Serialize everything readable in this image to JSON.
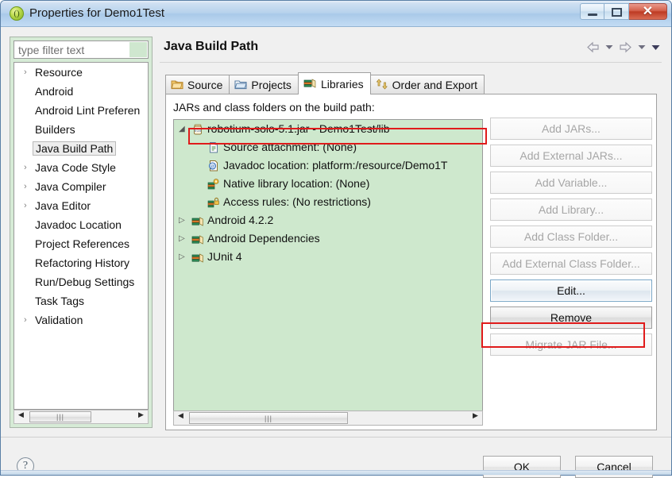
{
  "window": {
    "title": "Properties for Demo1Test",
    "icon": "eclipse-properties-icon",
    "minimize_label": "Minimize",
    "maximize_label": "Maximize",
    "close_label": "Close",
    "close_glyph": "✕"
  },
  "sidebar": {
    "filter": {
      "placeholder": "type filter text",
      "value": ""
    },
    "items": [
      {
        "label": "Resource",
        "expandable": true,
        "selected": false
      },
      {
        "label": "Android",
        "expandable": false,
        "selected": false
      },
      {
        "label": "Android Lint Preferen",
        "expandable": false,
        "selected": false
      },
      {
        "label": "Builders",
        "expandable": false,
        "selected": false
      },
      {
        "label": "Java Build Path",
        "expandable": false,
        "selected": true
      },
      {
        "label": "Java Code Style",
        "expandable": true,
        "selected": false
      },
      {
        "label": "Java Compiler",
        "expandable": true,
        "selected": false
      },
      {
        "label": "Java Editor",
        "expandable": true,
        "selected": false
      },
      {
        "label": "Javadoc Location",
        "expandable": false,
        "selected": false
      },
      {
        "label": "Project References",
        "expandable": false,
        "selected": false
      },
      {
        "label": "Refactoring History",
        "expandable": false,
        "selected": false
      },
      {
        "label": "Run/Debug Settings",
        "expandable": false,
        "selected": false
      },
      {
        "label": "Task Tags",
        "expandable": false,
        "selected": false
      },
      {
        "label": "Validation",
        "expandable": true,
        "selected": false
      }
    ]
  },
  "main": {
    "page_title": "Java Build Path",
    "tabs": [
      {
        "label": "Source",
        "icon": "source-folder-icon",
        "active": false
      },
      {
        "label": "Projects",
        "icon": "projects-folder-icon",
        "active": false
      },
      {
        "label": "Libraries",
        "icon": "libraries-books-icon",
        "active": true
      },
      {
        "label": "Order and Export",
        "icon": "order-export-arrows-icon",
        "active": false
      }
    ],
    "list_caption": "JARs and class folders on the build path:",
    "tree": [
      {
        "label": "robotium-solo-5.1.jar - Demo1Test/lib",
        "icon": "jar-icon",
        "indent": 0,
        "expander": "expanded",
        "highlighted": false
      },
      {
        "label": "Source attachment: (None)",
        "icon": "source-attachment-icon",
        "indent": 1,
        "expander": "none",
        "highlighted": false
      },
      {
        "label": "Javadoc location: platform:/resource/Demo1T",
        "icon": "javadoc-icon",
        "indent": 1,
        "expander": "none",
        "highlighted": true
      },
      {
        "label": "Native library location: (None)",
        "icon": "native-library-icon",
        "indent": 1,
        "expander": "none",
        "highlighted": false
      },
      {
        "label": "Access rules: (No restrictions)",
        "icon": "access-rules-icon",
        "indent": 1,
        "expander": "none",
        "highlighted": false
      },
      {
        "label": "Android 4.2.2",
        "icon": "library-books-icon",
        "indent": 0,
        "expander": "collapsed",
        "highlighted": false
      },
      {
        "label": "Android Dependencies",
        "icon": "library-books-icon",
        "indent": 0,
        "expander": "collapsed",
        "highlighted": false
      },
      {
        "label": "JUnit 4",
        "icon": "library-books-icon",
        "indent": 0,
        "expander": "collapsed",
        "highlighted": false
      }
    ],
    "buttons": [
      {
        "label": "Add JARs...",
        "state": "disabled"
      },
      {
        "label": "Add External JARs...",
        "state": "disabled"
      },
      {
        "label": "Add Variable...",
        "state": "disabled"
      },
      {
        "label": "Add Library...",
        "state": "disabled"
      },
      {
        "label": "Add Class Folder...",
        "state": "disabled"
      },
      {
        "label": "Add External Class Folder...",
        "state": "disabled"
      },
      {
        "label": "Edit...",
        "state": "focused"
      },
      {
        "label": "Remove",
        "state": "enabled"
      },
      {
        "label": "Migrate JAR File...",
        "state": "disabled"
      }
    ]
  },
  "navigation": {
    "back_label": "Back",
    "back_menu_label": "Back history",
    "forward_label": "Forward",
    "forward_menu_label": "Forward history",
    "view_menu_label": "View menu"
  },
  "footer": {
    "help_label": "?",
    "ok_label": "OK",
    "cancel_label": "Cancel"
  },
  "annotations": [
    {
      "name": "javadoc-row-highlight",
      "color": "#e01b1b"
    },
    {
      "name": "edit-button-highlight",
      "color": "#e01b1b"
    }
  ],
  "colors": {
    "list_background": "#cee8cd",
    "sidebar_background": "#d6ebd6",
    "titlebar": "#b6d2ec",
    "annotation_red": "#e01b1b"
  }
}
